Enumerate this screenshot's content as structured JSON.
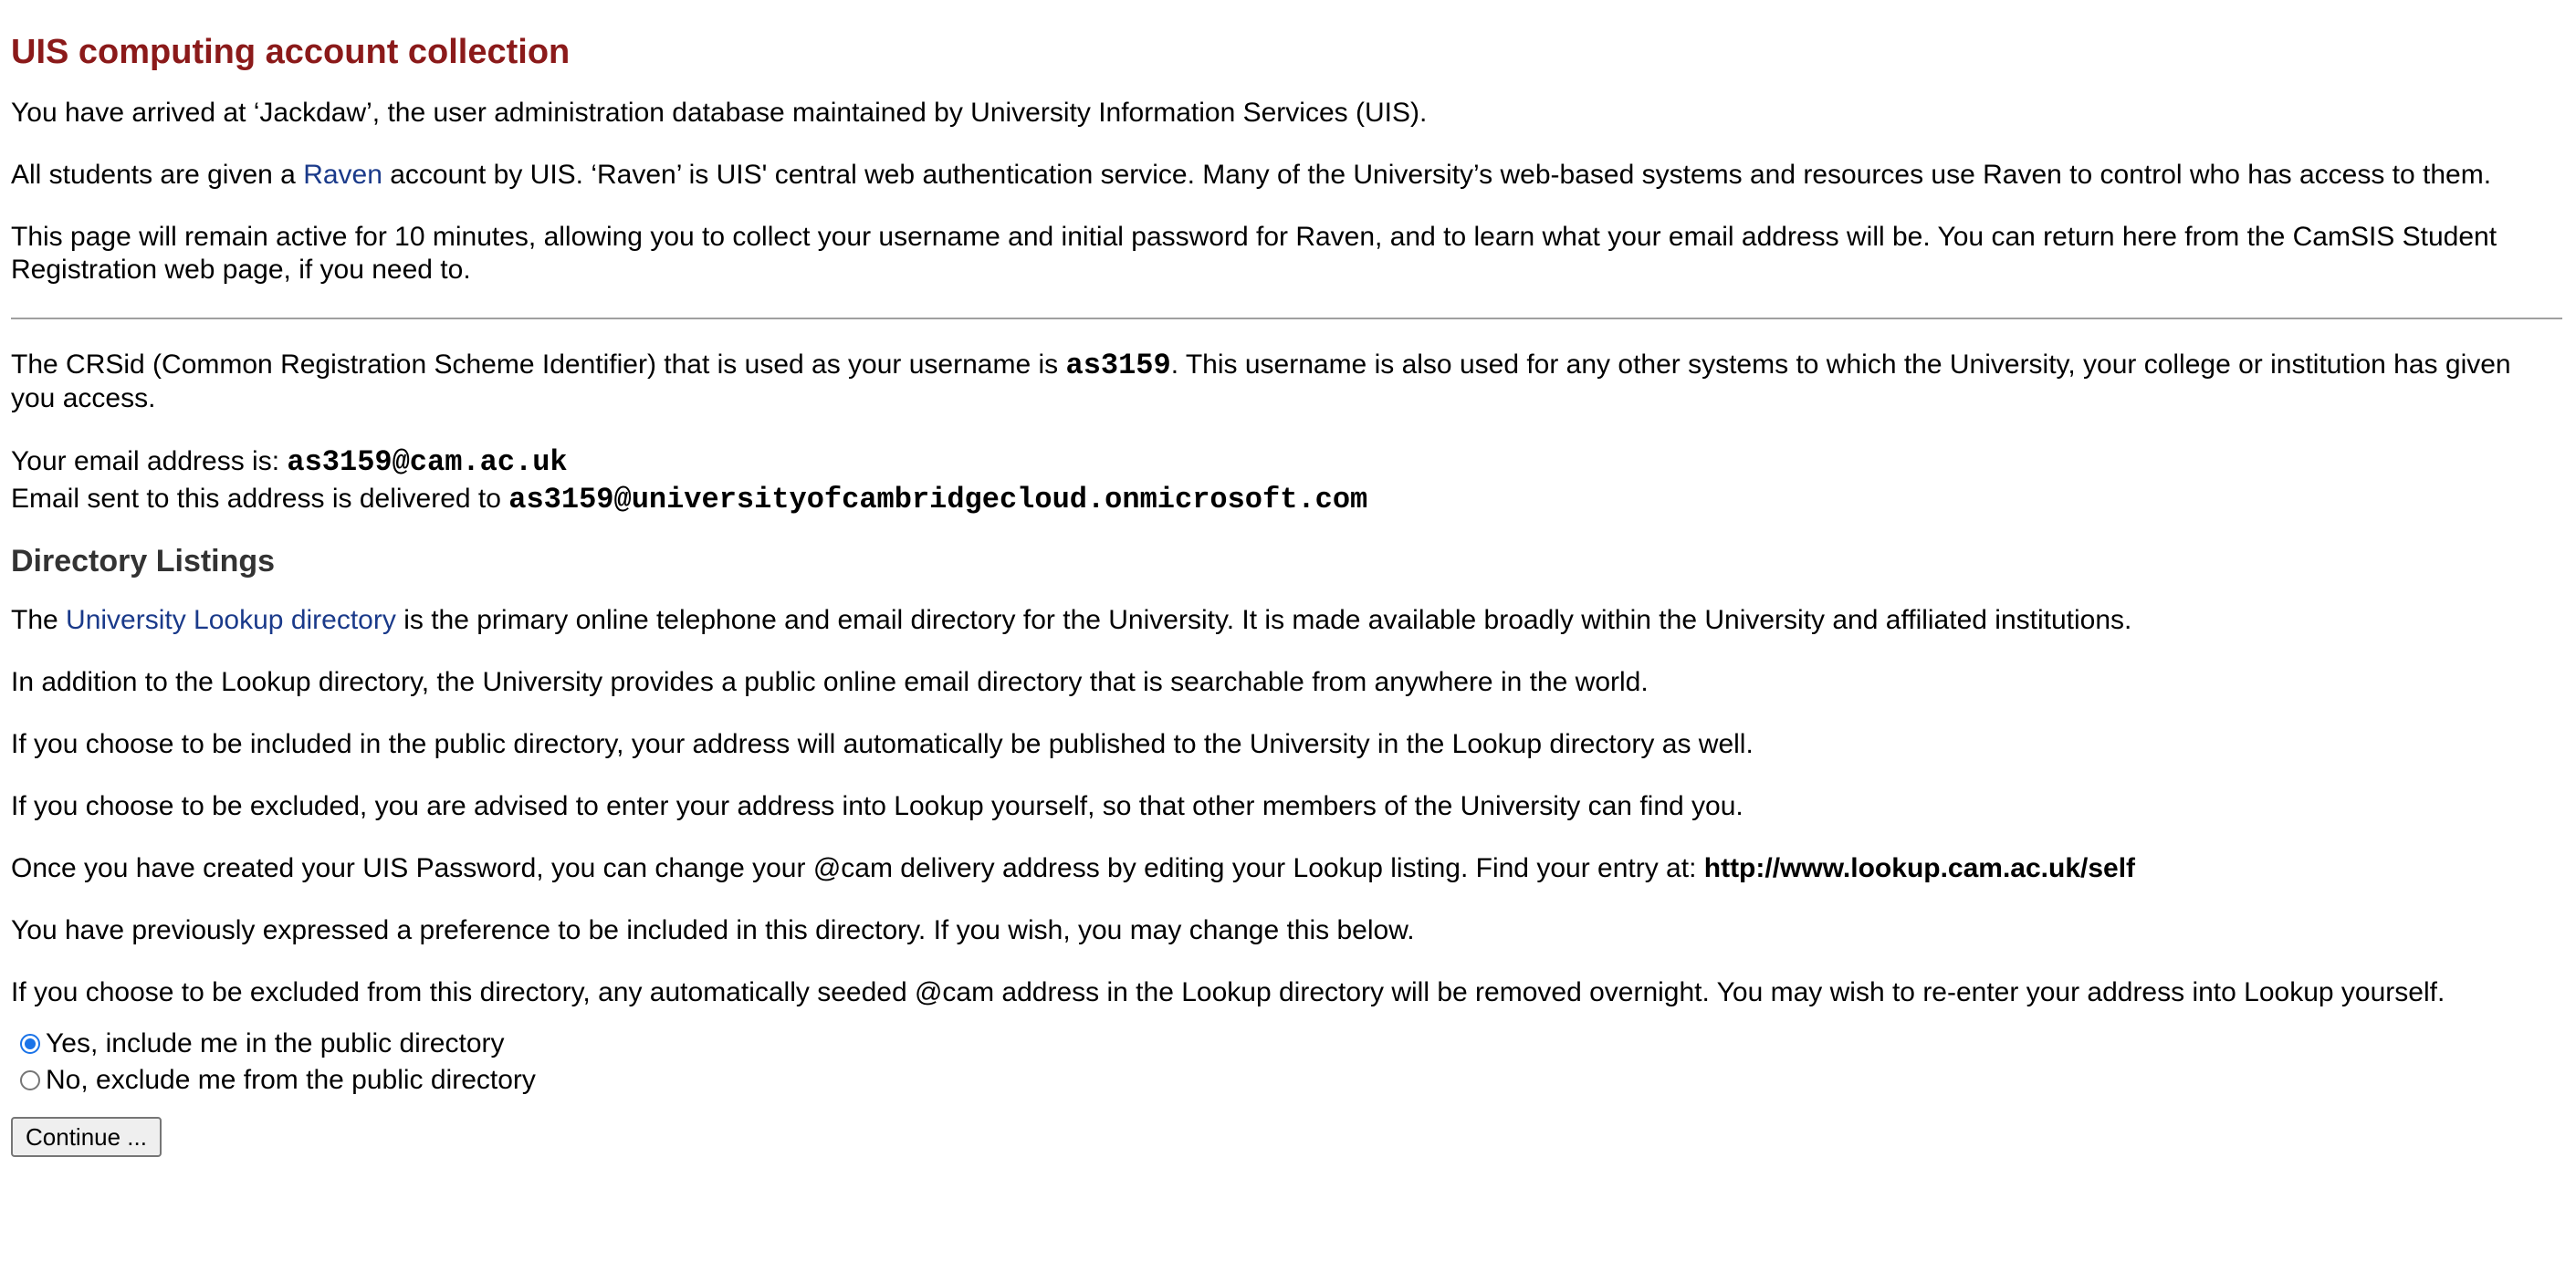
{
  "title": "UIS computing account collection",
  "intro": {
    "p1": "You have arrived at ‘Jackdaw’, the user administration database maintained by University Information Services (UIS).",
    "p2_before": "All students are given a ",
    "p2_link": "Raven",
    "p2_after": " account by UIS. ‘Raven’ is UIS' central web authentication service. Many of the University’s web-based systems and resources use Raven to control who has access to them.",
    "p3": "This page will remain active for 10 minutes, allowing you to collect your username and initial password for Raven, and to learn what your email address will be. You can return here from the CamSIS Student Registration web page, if you need to."
  },
  "account": {
    "crsid_before": "The CRSid (Common Registration Scheme Identifier) that is used as your username is ",
    "crsid": "as3159",
    "crsid_after": ". This username is also used for any other systems to which the University, your college or institution has given you access.",
    "email_label": "Your email address is: ",
    "email": "as3159@cam.ac.uk",
    "delivery_label": "Email sent to this address is delivered to ",
    "delivery_address": "as3159@universityofcambridgecloud.onmicrosoft.com"
  },
  "directory": {
    "heading": "Directory Listings",
    "p1_before": "The ",
    "p1_link": "University Lookup directory",
    "p1_after": " is the primary online telephone and email directory for the University. It is made available broadly within the University and affiliated institutions.",
    "p2": "In addition to the Lookup directory, the University provides a public online email directory that is searchable from anywhere in the world.",
    "p3": "If you choose to be included in the public directory, your address will automatically be published to the University in the Lookup directory as well.",
    "p4": "If you choose to be excluded, you are advised to enter your address into Lookup yourself, so that other members of the University can find you.",
    "p5_before": "Once you have created your UIS Password, you can change your @cam delivery address by editing your Lookup listing. Find your entry at: ",
    "p5_url": "http://www.lookup.cam.ac.uk/self",
    "p6": "You have previously expressed a preference to be included in this directory. If you wish, you may change this below.",
    "p7": "If you choose to be excluded from this directory, any automatically seeded @cam address in the Lookup directory will be removed overnight. You may wish to re-enter your address into Lookup yourself."
  },
  "options": {
    "include_label": "Yes, include me in the public directory",
    "include_checked": true,
    "exclude_label": "No, exclude me from the public directory",
    "exclude_checked": false
  },
  "continue_label": "Continue ...",
  "colors": {
    "title": "#8b1a1a",
    "link": "#1a3a8a",
    "radio_accent": "#1a73e8"
  }
}
